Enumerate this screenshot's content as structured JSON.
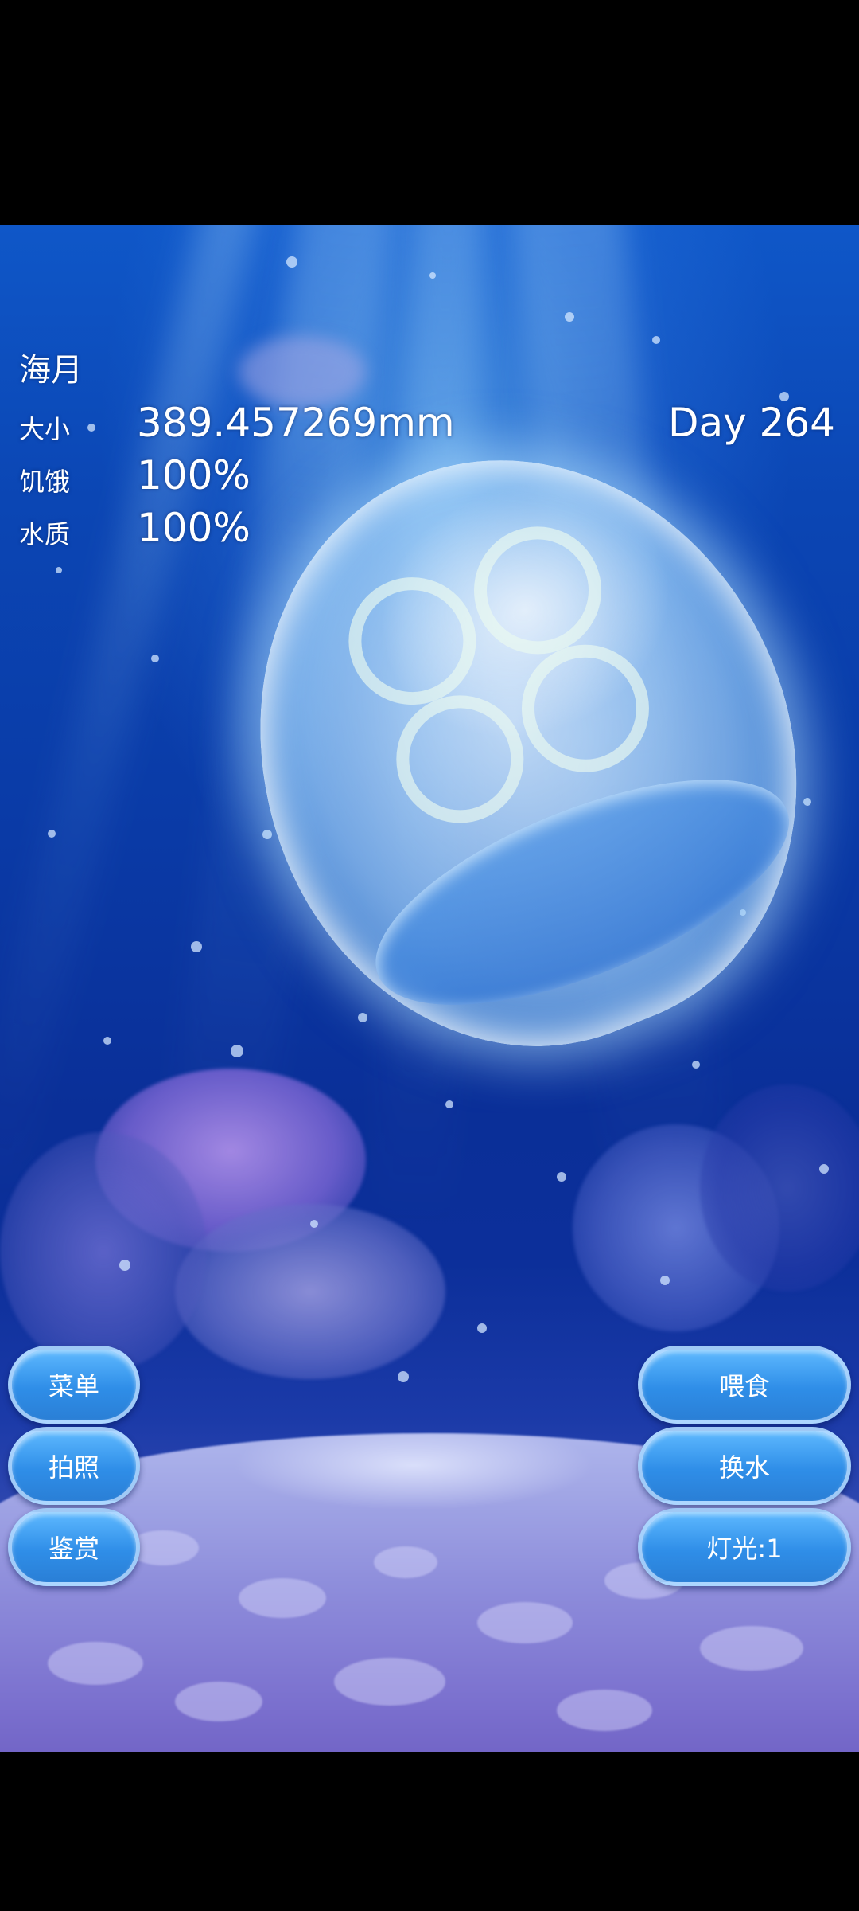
{
  "hud": {
    "species_name": "海月",
    "size_label": "大小",
    "size_value": "389.457269mm",
    "hunger_label": "饥饿",
    "hunger_value": "100%",
    "water_label": "水质",
    "water_value": "100%",
    "day_counter": "Day 264"
  },
  "buttons": {
    "menu": "菜单",
    "photo": "拍照",
    "gallery": "鉴赏",
    "feed": "喂食",
    "change_water": "换水",
    "light": "灯光:1"
  },
  "colors": {
    "ocean_top": "#0f57c8",
    "ocean_deep": "#0a2f98",
    "button_fill": "#2f8ee8",
    "text": "#ffffff"
  }
}
